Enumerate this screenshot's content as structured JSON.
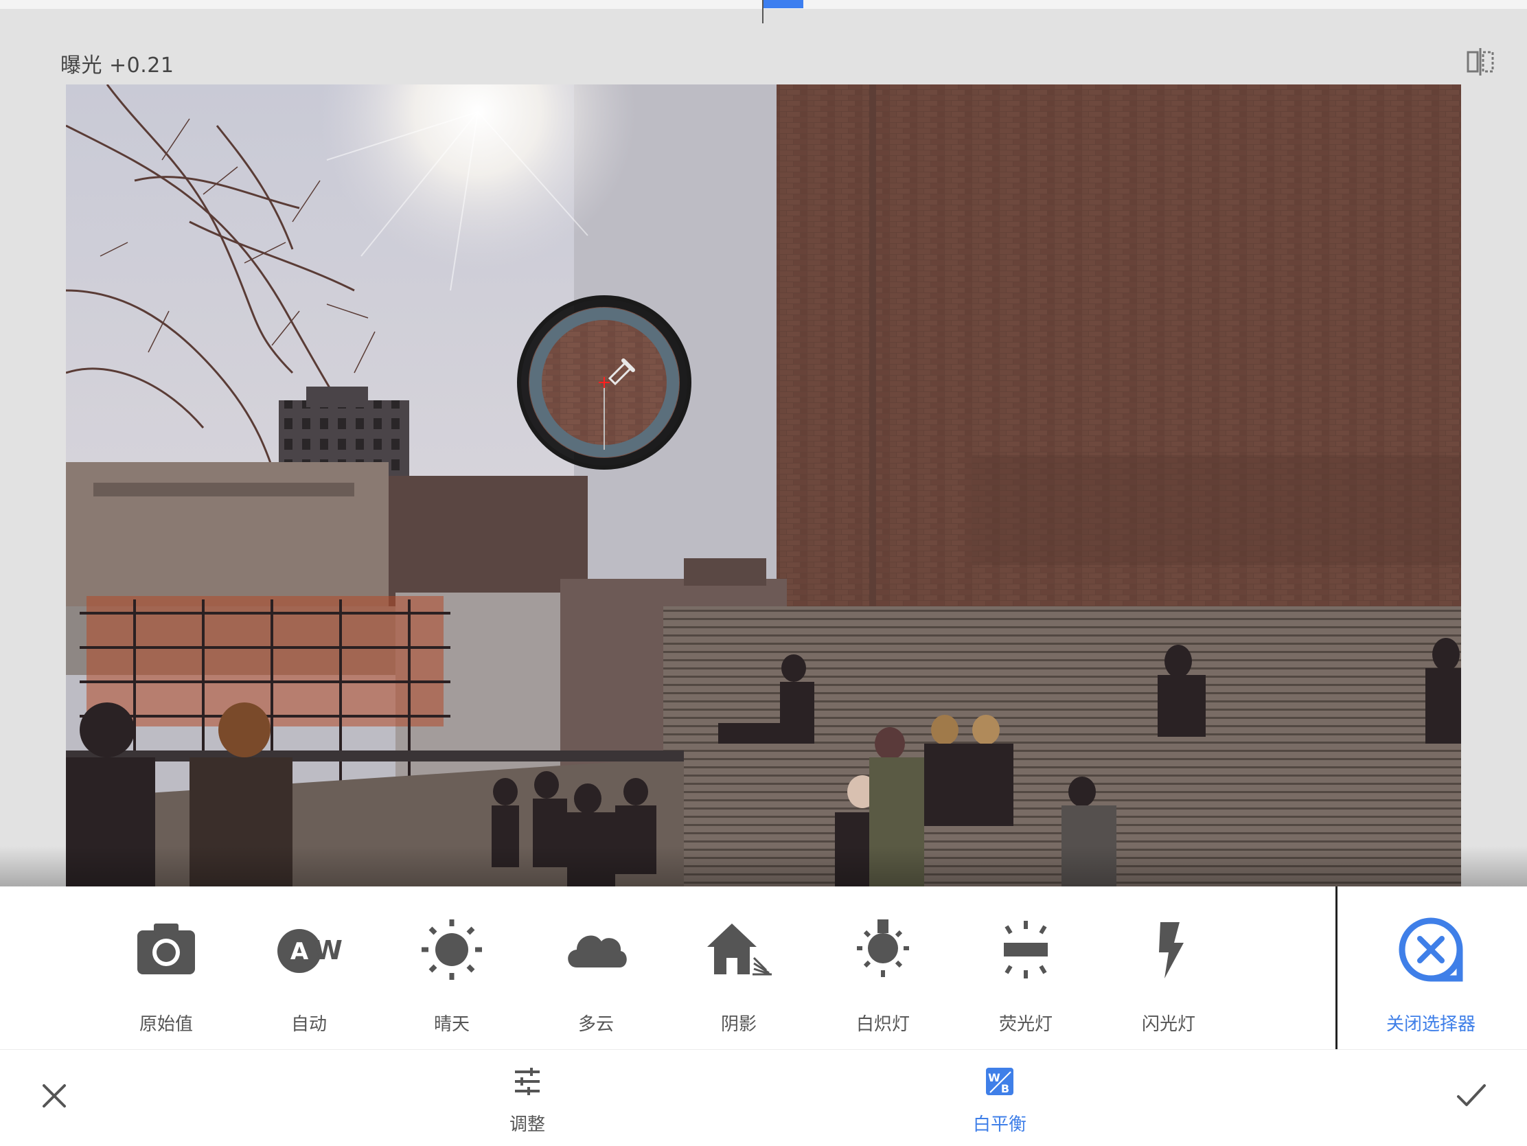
{
  "header": {
    "parameter_label": "曝光 +0.21",
    "compare_icon": "compare-icon"
  },
  "colors": {
    "accent": "#3f7fe8",
    "picker_ring": "#5b6f7c",
    "panel_bg": "#ffffff",
    "canvas_bg": "#e2e2e2"
  },
  "white_balance_presets": [
    {
      "label": "原始值",
      "icon": "camera-icon"
    },
    {
      "label": "自动",
      "icon": "auto-wb-icon"
    },
    {
      "label": "晴天",
      "icon": "sun-icon"
    },
    {
      "label": "多云",
      "icon": "cloud-icon"
    },
    {
      "label": "阴影",
      "icon": "shade-house-icon"
    },
    {
      "label": "白炽灯",
      "icon": "incandescent-bulb-icon"
    },
    {
      "label": "荧光灯",
      "icon": "fluorescent-lamp-icon"
    },
    {
      "label": "闪光灯",
      "icon": "flash-icon"
    }
  ],
  "close_picker": {
    "label": "关闭选择器",
    "icon": "close-circle-icon"
  },
  "toolbar": {
    "cancel_icon": "close-icon",
    "confirm_icon": "check-icon",
    "tabs": [
      {
        "label": "调整",
        "icon": "sliders-icon",
        "active": false
      },
      {
        "label": "白平衡",
        "icon": "white-balance-icon",
        "active": true
      }
    ]
  },
  "eyedropper": {
    "icon": "eyedropper-icon"
  }
}
